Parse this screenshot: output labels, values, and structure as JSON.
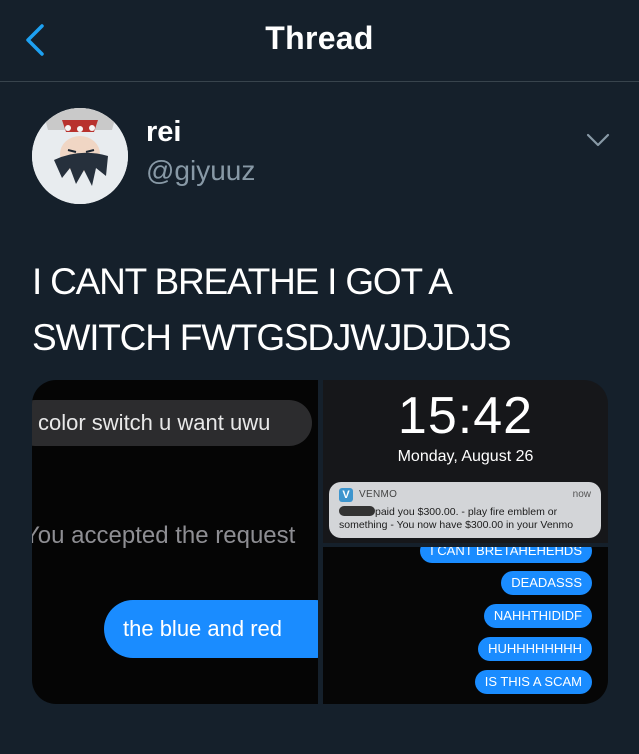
{
  "header": {
    "title": "Thread",
    "back_icon": "chevron-left-icon",
    "accent": "#1da1f2"
  },
  "tweet": {
    "display_name": "rei",
    "handle": "@giyuuz",
    "text": "I CANT BREATHE I GOT A\nSWITCH FWTGSDJWJDJDJS",
    "menu_icon": "chevron-down-icon"
  },
  "media": {
    "left": {
      "gray_message": "color switch u want uwu",
      "system_message": "You accepted the request",
      "blue_message": "the blue and red "
    },
    "top_right": {
      "time": "15:42",
      "date": "Monday, August 26",
      "notification": {
        "app": "VENMO",
        "when": "now",
        "body_line1": "paid you $300.00. - play fire emblem or",
        "body_line2": "something - You now have $300.00 in your Venmo"
      }
    },
    "bottom_right": {
      "messages": [
        "I CANT BRETAHEHEHDS",
        "DEADASSS",
        "NAHHTHIDIDF",
        "HUHHHHHHHH",
        "IS THIS A SCAM"
      ]
    }
  },
  "colors": {
    "background": "#15202b",
    "secondary_text": "#8899a6",
    "imessage_blue": "#1a8cff",
    "venmo_blue": "#3d95ce"
  }
}
